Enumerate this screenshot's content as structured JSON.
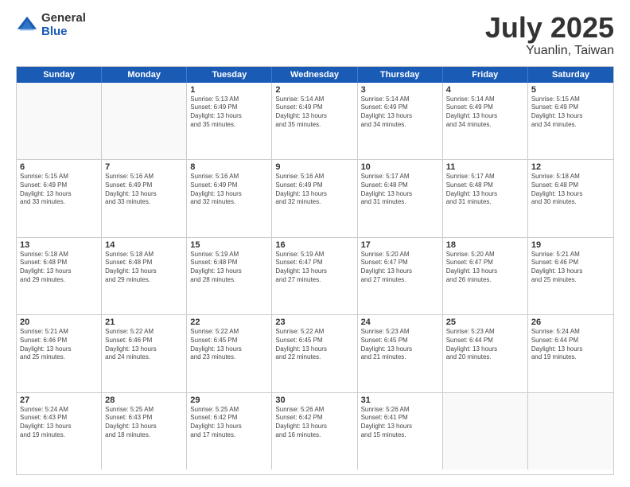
{
  "logo": {
    "general": "General",
    "blue": "Blue"
  },
  "title": "July 2025",
  "location": "Yuanlin, Taiwan",
  "weekdays": [
    "Sunday",
    "Monday",
    "Tuesday",
    "Wednesday",
    "Thursday",
    "Friday",
    "Saturday"
  ],
  "rows": [
    [
      {
        "day": "",
        "empty": true
      },
      {
        "day": "",
        "empty": true
      },
      {
        "day": "1",
        "lines": [
          "Sunrise: 5:13 AM",
          "Sunset: 6:49 PM",
          "Daylight: 13 hours",
          "and 35 minutes."
        ]
      },
      {
        "day": "2",
        "lines": [
          "Sunrise: 5:14 AM",
          "Sunset: 6:49 PM",
          "Daylight: 13 hours",
          "and 35 minutes."
        ]
      },
      {
        "day": "3",
        "lines": [
          "Sunrise: 5:14 AM",
          "Sunset: 6:49 PM",
          "Daylight: 13 hours",
          "and 34 minutes."
        ]
      },
      {
        "day": "4",
        "lines": [
          "Sunrise: 5:14 AM",
          "Sunset: 6:49 PM",
          "Daylight: 13 hours",
          "and 34 minutes."
        ]
      },
      {
        "day": "5",
        "lines": [
          "Sunrise: 5:15 AM",
          "Sunset: 6:49 PM",
          "Daylight: 13 hours",
          "and 34 minutes."
        ]
      }
    ],
    [
      {
        "day": "6",
        "lines": [
          "Sunrise: 5:15 AM",
          "Sunset: 6:49 PM",
          "Daylight: 13 hours",
          "and 33 minutes."
        ]
      },
      {
        "day": "7",
        "lines": [
          "Sunrise: 5:16 AM",
          "Sunset: 6:49 PM",
          "Daylight: 13 hours",
          "and 33 minutes."
        ]
      },
      {
        "day": "8",
        "lines": [
          "Sunrise: 5:16 AM",
          "Sunset: 6:49 PM",
          "Daylight: 13 hours",
          "and 32 minutes."
        ]
      },
      {
        "day": "9",
        "lines": [
          "Sunrise: 5:16 AM",
          "Sunset: 6:49 PM",
          "Daylight: 13 hours",
          "and 32 minutes."
        ]
      },
      {
        "day": "10",
        "lines": [
          "Sunrise: 5:17 AM",
          "Sunset: 6:48 PM",
          "Daylight: 13 hours",
          "and 31 minutes."
        ]
      },
      {
        "day": "11",
        "lines": [
          "Sunrise: 5:17 AM",
          "Sunset: 6:48 PM",
          "Daylight: 13 hours",
          "and 31 minutes."
        ]
      },
      {
        "day": "12",
        "lines": [
          "Sunrise: 5:18 AM",
          "Sunset: 6:48 PM",
          "Daylight: 13 hours",
          "and 30 minutes."
        ]
      }
    ],
    [
      {
        "day": "13",
        "lines": [
          "Sunrise: 5:18 AM",
          "Sunset: 6:48 PM",
          "Daylight: 13 hours",
          "and 29 minutes."
        ]
      },
      {
        "day": "14",
        "lines": [
          "Sunrise: 5:18 AM",
          "Sunset: 6:48 PM",
          "Daylight: 13 hours",
          "and 29 minutes."
        ]
      },
      {
        "day": "15",
        "lines": [
          "Sunrise: 5:19 AM",
          "Sunset: 6:48 PM",
          "Daylight: 13 hours",
          "and 28 minutes."
        ]
      },
      {
        "day": "16",
        "lines": [
          "Sunrise: 5:19 AM",
          "Sunset: 6:47 PM",
          "Daylight: 13 hours",
          "and 27 minutes."
        ]
      },
      {
        "day": "17",
        "lines": [
          "Sunrise: 5:20 AM",
          "Sunset: 6:47 PM",
          "Daylight: 13 hours",
          "and 27 minutes."
        ]
      },
      {
        "day": "18",
        "lines": [
          "Sunrise: 5:20 AM",
          "Sunset: 6:47 PM",
          "Daylight: 13 hours",
          "and 26 minutes."
        ]
      },
      {
        "day": "19",
        "lines": [
          "Sunrise: 5:21 AM",
          "Sunset: 6:46 PM",
          "Daylight: 13 hours",
          "and 25 minutes."
        ]
      }
    ],
    [
      {
        "day": "20",
        "lines": [
          "Sunrise: 5:21 AM",
          "Sunset: 6:46 PM",
          "Daylight: 13 hours",
          "and 25 minutes."
        ]
      },
      {
        "day": "21",
        "lines": [
          "Sunrise: 5:22 AM",
          "Sunset: 6:46 PM",
          "Daylight: 13 hours",
          "and 24 minutes."
        ]
      },
      {
        "day": "22",
        "lines": [
          "Sunrise: 5:22 AM",
          "Sunset: 6:45 PM",
          "Daylight: 13 hours",
          "and 23 minutes."
        ]
      },
      {
        "day": "23",
        "lines": [
          "Sunrise: 5:22 AM",
          "Sunset: 6:45 PM",
          "Daylight: 13 hours",
          "and 22 minutes."
        ]
      },
      {
        "day": "24",
        "lines": [
          "Sunrise: 5:23 AM",
          "Sunset: 6:45 PM",
          "Daylight: 13 hours",
          "and 21 minutes."
        ]
      },
      {
        "day": "25",
        "lines": [
          "Sunrise: 5:23 AM",
          "Sunset: 6:44 PM",
          "Daylight: 13 hours",
          "and 20 minutes."
        ]
      },
      {
        "day": "26",
        "lines": [
          "Sunrise: 5:24 AM",
          "Sunset: 6:44 PM",
          "Daylight: 13 hours",
          "and 19 minutes."
        ]
      }
    ],
    [
      {
        "day": "27",
        "lines": [
          "Sunrise: 5:24 AM",
          "Sunset: 6:43 PM",
          "Daylight: 13 hours",
          "and 19 minutes."
        ]
      },
      {
        "day": "28",
        "lines": [
          "Sunrise: 5:25 AM",
          "Sunset: 6:43 PM",
          "Daylight: 13 hours",
          "and 18 minutes."
        ]
      },
      {
        "day": "29",
        "lines": [
          "Sunrise: 5:25 AM",
          "Sunset: 6:42 PM",
          "Daylight: 13 hours",
          "and 17 minutes."
        ]
      },
      {
        "day": "30",
        "lines": [
          "Sunrise: 5:26 AM",
          "Sunset: 6:42 PM",
          "Daylight: 13 hours",
          "and 16 minutes."
        ]
      },
      {
        "day": "31",
        "lines": [
          "Sunrise: 5:26 AM",
          "Sunset: 6:41 PM",
          "Daylight: 13 hours",
          "and 15 minutes."
        ]
      },
      {
        "day": "",
        "empty": true
      },
      {
        "day": "",
        "empty": true
      }
    ]
  ]
}
